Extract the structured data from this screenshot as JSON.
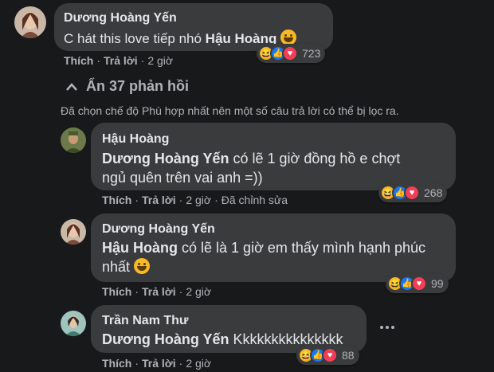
{
  "comment": {
    "author": "Dương Hoàng Yến",
    "text_prefix": "C hát this love tiếp nhó ",
    "mention": "Hậu Hoàng",
    "actions": {
      "like": "Thích",
      "reply": "Trả lời",
      "time": "2 giờ"
    },
    "reactions": {
      "icons": [
        "haha-icon",
        "like-icon",
        "love-icon"
      ],
      "count": "723"
    }
  },
  "replies_toggle": {
    "label": "Ẩn 37 phản hồi",
    "icon": "chevron-up-icon"
  },
  "filter_notice": "Đã chọn chế độ Phù hợp nhất nên một số câu trả lời có thể bị lọc ra.",
  "replies": [
    {
      "author": "Hậu Hoàng",
      "mention": "Dương Hoàng Yến",
      "text": " có lẽ 1 giờ đồng hồ e chợt ngủ quên trên vai anh =))",
      "actions": {
        "like": "Thích",
        "reply": "Trả lời",
        "time": "2 giờ",
        "edited": "Đã chỉnh sửa"
      },
      "reactions": {
        "count": "268"
      }
    },
    {
      "author": "Dương Hoàng Yến",
      "mention": "Hậu Hoàng",
      "text": " có lẽ là 1 giờ em thấy mình hạnh phúc nhất ",
      "actions": {
        "like": "Thích",
        "reply": "Trả lời",
        "time": "2 giờ"
      },
      "reactions": {
        "count": "99"
      }
    },
    {
      "author": "Trần Nam Thư",
      "mention": "Dương Hoàng Yến",
      "text": " Kkkkkkkkkkkkkkk",
      "actions": {
        "like": "Thích",
        "reply": "Trả lời",
        "time": "2 giờ"
      },
      "reactions": {
        "count": "88"
      },
      "more_icon": "more-options-icon"
    }
  ],
  "colors": {
    "background": "#18191a",
    "bubble": "#3a3b3c",
    "text": "#e4e6eb",
    "secondary": "#b0b3b8"
  }
}
